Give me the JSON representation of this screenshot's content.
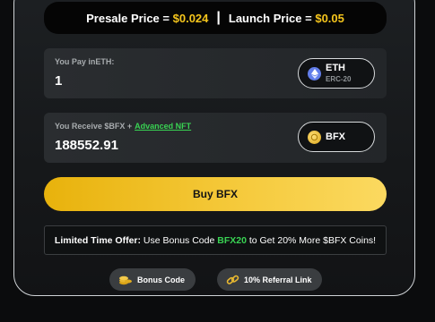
{
  "presale": {
    "presale_label": "Presale Price =",
    "presale_value": "$0.024",
    "separator": "|",
    "launch_label": "Launch Price =",
    "launch_value": "$0.05"
  },
  "pay": {
    "label": "You Pay inETH:",
    "amount": "1",
    "token": {
      "name": "ETH",
      "network": "ERC-20",
      "icon": "ethereum-icon"
    }
  },
  "receive": {
    "label_prefix": "You Receive $BFX +",
    "link": "Advanced NFT",
    "amount": "188552.91",
    "token": {
      "name": "BFX",
      "icon": "bfx-coin-icon"
    }
  },
  "buy_button": {
    "label": "Buy BFX"
  },
  "offer": {
    "lead": "Limited Time Offer:",
    "text_before": "Use Bonus Code",
    "code": "BFX20",
    "text_after": "to Get 20% More $BFX Coins!"
  },
  "pills": {
    "bonus": {
      "label": "Bonus Code",
      "icon": "coins-icon"
    },
    "referral": {
      "label": "10% Referral Link",
      "icon": "link-icon"
    }
  },
  "colors": {
    "gold": "#f5c51c",
    "green": "#39d353",
    "buy_gradient_start": "#e8b20c",
    "buy_gradient_end": "#fbd960"
  }
}
